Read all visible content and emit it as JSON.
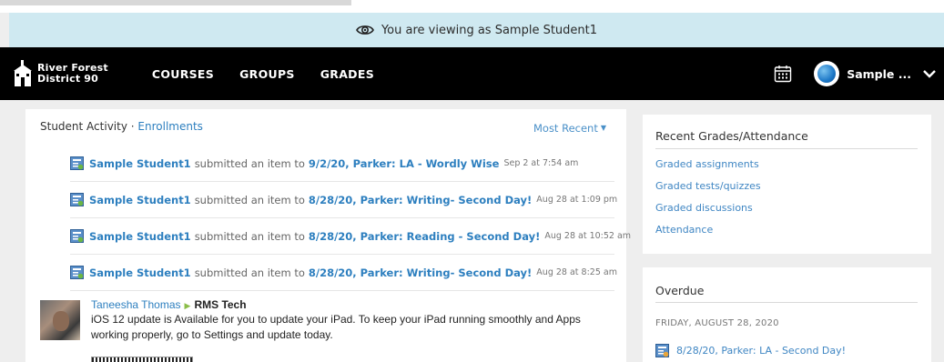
{
  "banner": {
    "text": "You are viewing as Sample Student1"
  },
  "header": {
    "logo_line1": "River Forest",
    "logo_line2": "District 90",
    "nav": [
      "COURSES",
      "GROUPS",
      "GRADES"
    ],
    "user_name": "Sample ..."
  },
  "activity": {
    "heading": "Student Activity",
    "separator": "·",
    "enrollments_link": "Enrollments",
    "sort_label": "Most Recent",
    "items": [
      {
        "who": "Sample Student1",
        "verb": "submitted an item to",
        "item": "9/2/20, Parker: LA - Wordly Wise",
        "date": "Sep 2 at 7:54 am"
      },
      {
        "who": "Sample Student1",
        "verb": "submitted an item to",
        "item": "8/28/20, Parker: Writing- Second Day!",
        "date": "Aug 28 at 1:09 pm"
      },
      {
        "who": "Sample Student1",
        "verb": "submitted an item to",
        "item": "8/28/20, Parker: Reading - Second Day!",
        "date": "Aug 28 at 10:52 am"
      },
      {
        "who": "Sample Student1",
        "verb": "submitted an item to",
        "item": "8/28/20, Parker: Writing- Second Day!",
        "date": "Aug 28 at 8:25 am"
      }
    ],
    "post": {
      "author": "Taneesha Thomas",
      "group": "RMS Tech",
      "line1": "iOS 12 update is Available for you to update your iPad.  To keep your iPad running smoothly and Apps",
      "line2": "working properly, go to Settings and update today."
    }
  },
  "recent": {
    "title": "Recent Grades/Attendance",
    "links": [
      "Graded assignments",
      "Graded tests/quizzes",
      "Graded discussions",
      "Attendance"
    ]
  },
  "overdue": {
    "title": "Overdue",
    "date": "FRIDAY, AUGUST 28, 2020",
    "item": "8/28/20, Parker: LA - Second Day!"
  },
  "colors": {
    "link": "#2d7fbf",
    "banner": "#cfe9f1",
    "nav": "#000000"
  },
  "icons": [
    "eye-icon",
    "calendar-icon",
    "chevron-down-icon",
    "assignment-icon"
  ]
}
